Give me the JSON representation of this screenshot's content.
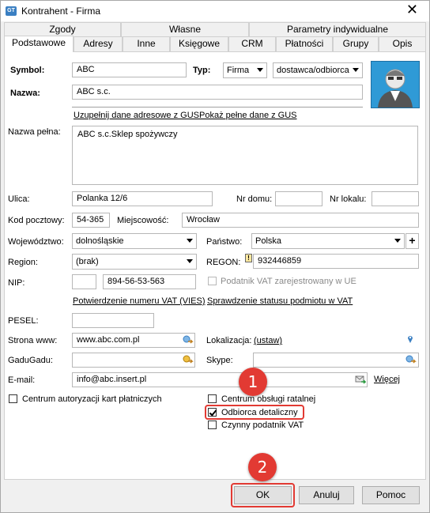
{
  "window": {
    "title": "Kontrahent - Firma",
    "close": "✕"
  },
  "tabs_row1": [
    "Zgody",
    "Własne",
    "Parametry indywidualne"
  ],
  "tabs_row2": [
    "Podstawowe",
    "Adresy",
    "Inne",
    "Księgowe",
    "CRM",
    "Płatności",
    "Grupy",
    "Opis"
  ],
  "form": {
    "symbol_label": "Symbol:",
    "symbol_value": "ABC",
    "typ_label": "Typ:",
    "typ_value": "Firma",
    "typ2_value": "dostawca/odbiorca",
    "nazwa_label": "Nazwa:",
    "nazwa_value": "ABC s.c.",
    "gus_link": "Uzupełnij dane adresowe z GUS",
    "gus_full_link": "Pokaż pełne dane z GUS",
    "nazwa_pelna_label": "Nazwa pełna:",
    "nazwa_pelna_value": "ABC s.c.Sklep spożywczy",
    "ulica_label": "Ulica:",
    "ulica_value": "Polanka  12/6",
    "nr_domu_label": "Nr domu:",
    "nr_domu_value": "",
    "nr_lokalu_label": "Nr lokalu:",
    "nr_lokalu_value": "",
    "kod_label": "Kod pocztowy:",
    "kod_value": "54-365",
    "miejscowosc_label": "Miejscowość:",
    "miejscowosc_value": "Wrocław",
    "woj_label": "Województwo:",
    "woj_value": "dolnośląskie",
    "panstwo_label": "Państwo:",
    "panstwo_value": "Polska",
    "panstwo_add": "+",
    "region_label": "Region:",
    "region_value": "(brak)",
    "regon_label": "REGON:",
    "regon_warn": "!",
    "regon_value": "932446859",
    "nip_label": "NIP:",
    "nip_prefix": "",
    "nip_value": "894-56-53-563",
    "vat_ue_label": "Podatnik VAT zarejestrowany w UE",
    "vies_link": "Potwierdzenie numeru VAT (VIES)",
    "vat_status_link": "Sprawdzenie statusu podmiotu w VAT",
    "pesel_label": "PESEL:",
    "pesel_value": "",
    "www_label": "Strona www:",
    "www_value": "www.abc.com.pl",
    "lokalizacja_label": "Lokalizacja:",
    "lokalizacja_link": "(ustaw)",
    "gadu_label": "GaduGadu:",
    "gadu_value": "",
    "skype_label": "Skype:",
    "skype_value": "",
    "email_label": "E-mail:",
    "email_value": "info@abc.insert.pl",
    "wiecej_link": "Więcej",
    "centrum_kart_label": "Centrum autoryzacji kart płatniczych",
    "centrum_ratalne_label": "Centrum obsługi ratalnej",
    "odbiorca_label": "Odbiorca detaliczny",
    "czynny_vat_label": "Czynny podatnik VAT"
  },
  "checkboxes": {
    "centrum_kart": false,
    "centrum_ratalne": false,
    "odbiorca": true,
    "czynny_vat": false,
    "vat_ue": false
  },
  "buttons": {
    "ok": "OK",
    "cancel": "Anuluj",
    "help": "Pomoc"
  },
  "markers": {
    "m1": "1",
    "m2": "2"
  },
  "colors": {
    "marker": "#e23a33",
    "icon_blue": "#3a7fc2"
  }
}
